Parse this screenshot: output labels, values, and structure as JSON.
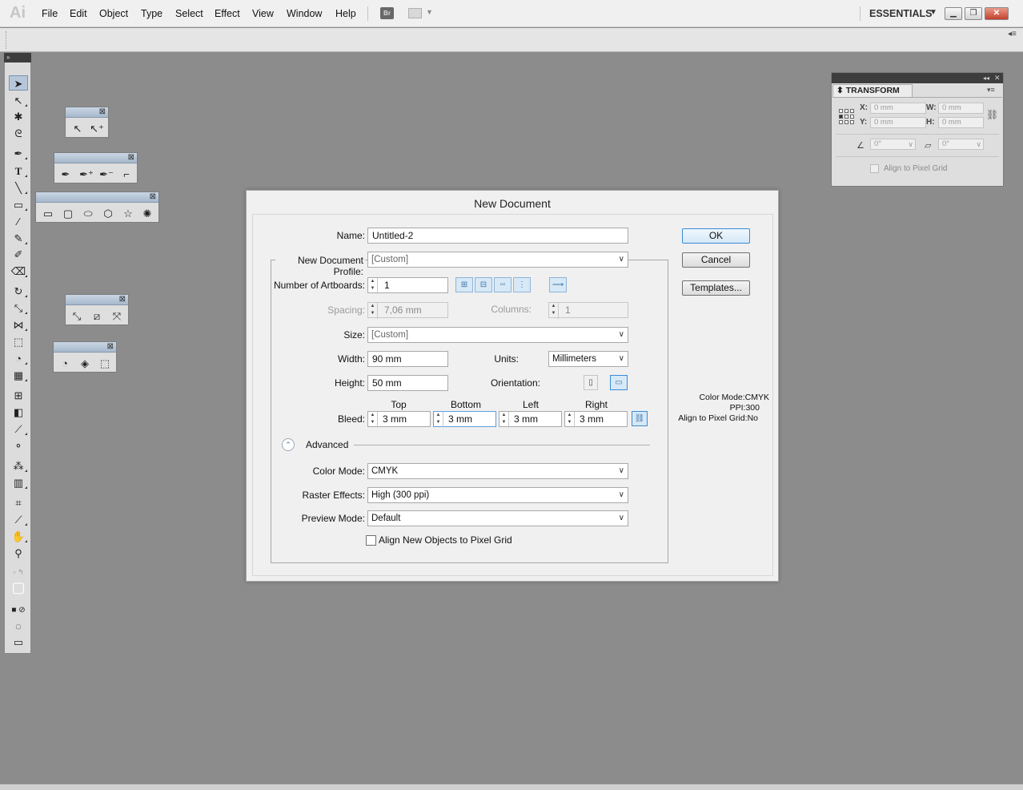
{
  "app": {
    "logo_text": "Ai"
  },
  "menu": [
    "File",
    "Edit",
    "Object",
    "Type",
    "Select",
    "Effect",
    "View",
    "Window",
    "Help"
  ],
  "menubar_icons": {
    "bridge_label": "Br"
  },
  "workspace": {
    "label": "ESSENTIALS"
  },
  "transform_panel": {
    "tab_label": "TRANSFORM",
    "x_label": "X:",
    "x_value": "0 mm",
    "y_label": "Y:",
    "y_value": "0 mm",
    "w_label": "W:",
    "w_value": "0 mm",
    "h_label": "H:",
    "h_value": "0 mm",
    "rotate_value": "0°",
    "shear_value": "0°",
    "align_pixel_label": "Align to Pixel Grid"
  },
  "dialog": {
    "title": "New Document",
    "name_label": "Name:",
    "name_value": "Untitled-2",
    "profile_label": "New Document Profile:",
    "profile_value": "[Custom]",
    "artboards_label": "Number of Artboards:",
    "artboards_value": "1",
    "spacing_label": "Spacing:",
    "spacing_value": "7,06 mm",
    "columns_label": "Columns:",
    "columns_value": "1",
    "size_label": "Size:",
    "size_value": "[Custom]",
    "width_label": "Width:",
    "width_value": "90 mm",
    "units_label": "Units:",
    "units_value": "Millimeters",
    "height_label": "Height:",
    "height_value": "50 mm",
    "orientation_label": "Orientation:",
    "bleed_label": "Bleed:",
    "bleed_top_label": "Top",
    "bleed_bottom_label": "Bottom",
    "bleed_left_label": "Left",
    "bleed_right_label": "Right",
    "bleed_top_value": "3 mm",
    "bleed_bottom_value": "3 mm",
    "bleed_left_value": "3 mm",
    "bleed_right_value": "3 mm",
    "advanced_label": "Advanced",
    "color_mode_label": "Color Mode:",
    "color_mode_value": "CMYK",
    "raster_label": "Raster Effects:",
    "raster_value": "High (300 ppi)",
    "preview_label": "Preview Mode:",
    "preview_value": "Default",
    "align_checkbox_label": "Align New Objects to Pixel Grid",
    "ok_label": "OK",
    "cancel_label": "Cancel",
    "templates_label": "Templates...",
    "info_color_mode": "Color Mode:CMYK",
    "info_ppi": "PPI:300",
    "info_align": "Align to Pixel Grid:No"
  },
  "colors": {
    "workspace_bg": "#8c8c8c",
    "accent_blue": "#3a8cd6"
  }
}
